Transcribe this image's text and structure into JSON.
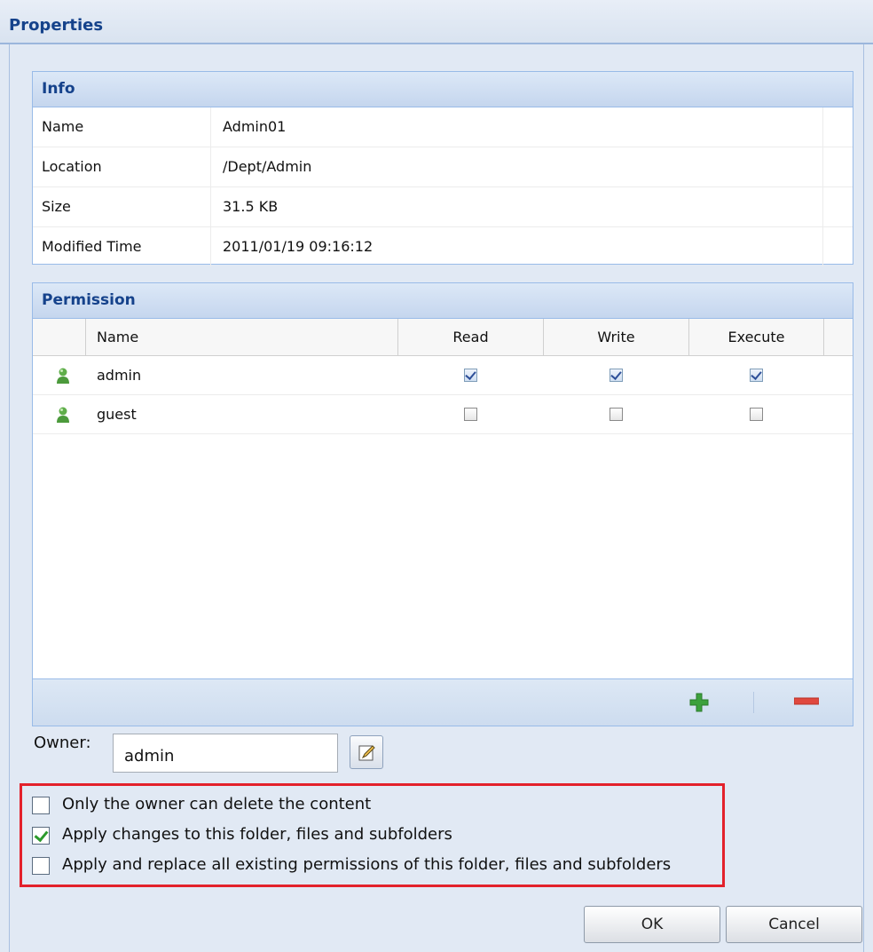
{
  "window": {
    "title": "Properties"
  },
  "info": {
    "title": "Info",
    "rows": [
      {
        "label": "Name",
        "value": "Admin01"
      },
      {
        "label": "Location",
        "value": "/Dept/Admin"
      },
      {
        "label": "Size",
        "value": "31.5 KB"
      },
      {
        "label": "Modified Time",
        "value": "2011/01/19 09:16:12"
      }
    ]
  },
  "permission": {
    "title": "Permission",
    "columns": {
      "name": "Name",
      "read": "Read",
      "write": "Write",
      "execute": "Execute"
    },
    "rows": [
      {
        "name": "admin",
        "read": true,
        "write": true,
        "execute": true,
        "icon": "user-icon"
      },
      {
        "name": "guest",
        "read": false,
        "write": false,
        "execute": false,
        "icon": "user-icon"
      }
    ],
    "toolbar": {
      "add_icon": "plus-icon",
      "remove_icon": "minus-icon"
    }
  },
  "owner": {
    "label": "Owner:",
    "value": "admin",
    "edit_icon": "edit-icon"
  },
  "options": [
    {
      "label": "Only the owner can delete the content",
      "checked": false
    },
    {
      "label": "Apply changes to this folder, files and subfolders",
      "checked": true
    },
    {
      "label": "Apply and replace all existing permissions of this folder, files and subfolders",
      "checked": false
    }
  ],
  "buttons": {
    "ok": "OK",
    "cancel": "Cancel"
  },
  "colors": {
    "accent": "#15428b",
    "highlight_border": "#e3212b",
    "add_green": "#3da13d",
    "remove_red": "#e0483e"
  }
}
